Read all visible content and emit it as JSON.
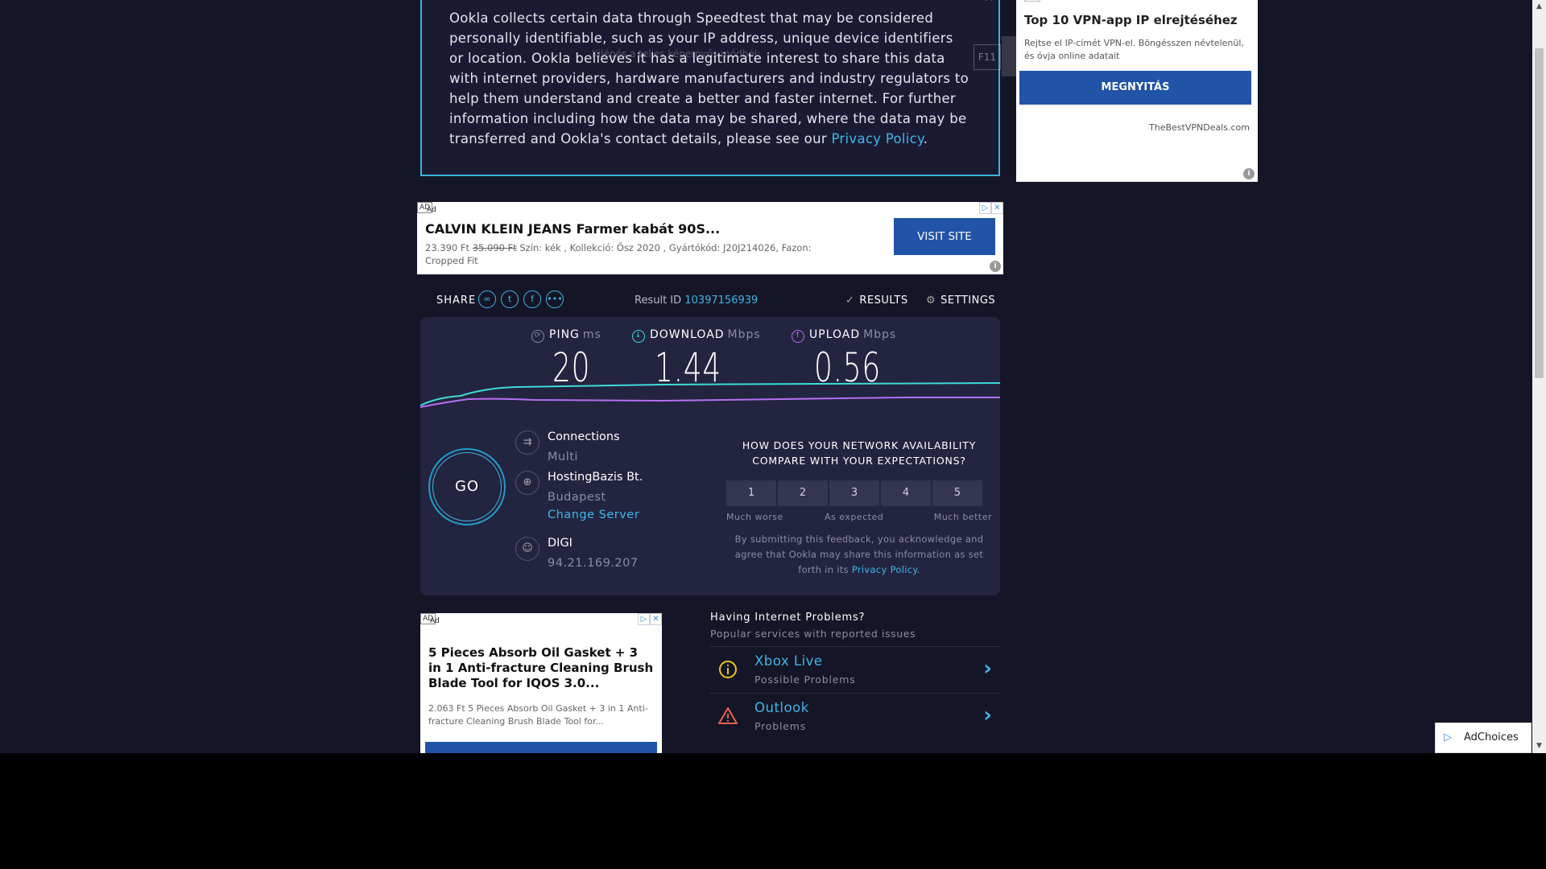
{
  "privacy": {
    "text": "Ookla collects certain data through Speedtest that may be considered personally identifiable, such as your IP address, unique device identifiers or location. Ookla believes it has a legitimate interest to share this data with internet providers, hardware manufacturers and industry regulators to help them understand and create a better and faster internet. For further information including how the data may be shared, where the data may be transferred and Ookla's contact details, please see our ",
    "link": "Privacy Policy",
    "end": "."
  },
  "fullscreen_hint": {
    "text": "Kilépés a teljes képernyős módból:",
    "key": "F11"
  },
  "ad_right": {
    "title": "Top 10 VPN-app IP elrejtéséhez",
    "desc": "Rejtse el IP-címét VPN-el. Böngésszen névtelenül, és óvja online adatait",
    "button": "MEGNYITÁS",
    "source": "TheBestVPNDeals.com"
  },
  "ad_banner": {
    "tag": "AD",
    "tag2": "Ad",
    "title": "CALVIN KLEIN JEANS Farmer kabát 90S...",
    "desc_price": "23.390 Ft",
    "desc_old": "35.090 Ft",
    "desc_rest": " Szín: kék , Kollekció: Ősz 2020 , Gyártókód: J20J214026, Fazon: Cropped Fit",
    "button": "VISIT SITE"
  },
  "share": {
    "label": "SHARE",
    "result_id_label": "Result ID",
    "result_id": "10397156939",
    "results": "RESULTS",
    "settings": "SETTINGS"
  },
  "metrics": {
    "ping": {
      "label": "PING",
      "unit": "ms",
      "value": "20"
    },
    "download": {
      "label": "DOWNLOAD",
      "unit": "Mbps",
      "value": "1.44"
    },
    "upload": {
      "label": "UPLOAD",
      "unit": "Mbps",
      "value": "0.56"
    }
  },
  "go": "GO",
  "connections": {
    "label": "Connections",
    "value": "Multi"
  },
  "server": {
    "name": "HostingBazis Bt.",
    "city": "Budapest",
    "change": "Change Server"
  },
  "isp": {
    "name": "DIGI",
    "ip": "94.21.169.207"
  },
  "survey": {
    "question": "HOW DOES YOUR NETWORK AVAILABILITY COMPARE WITH YOUR EXPECTATIONS?",
    "options": [
      "1",
      "2",
      "3",
      "4",
      "5"
    ],
    "low": "Much worse",
    "mid": "As expected",
    "high": "Much better",
    "note": "By submitting this feedback, you acknowledge and agree that Ookla may share this information as set forth in its ",
    "note_link": "Privacy Policy",
    "note_end": "."
  },
  "ad_bottom": {
    "tag": "AD",
    "tag2": "Ad",
    "title": "5 Pieces Absorb Oil Gasket + 3 in 1 Anti-fracture Cleaning Brush Blade Tool for IQOS 3.0...",
    "desc": "2.063 Ft 5 Pieces Absorb Oil Gasket + 3 in 1 Anti-fracture Cleaning Brush Blade Tool for..."
  },
  "problems": {
    "heading": "Having Internet Problems?",
    "subheading": "Popular services with reported issues",
    "items": [
      {
        "name": "Xbox Live",
        "status": "Possible Problems",
        "icon": "info-icon",
        "color": "#f0c419"
      },
      {
        "name": "Outlook",
        "status": "Problems",
        "icon": "warning-icon",
        "color": "#e8604c"
      }
    ]
  },
  "adchoices": "AdChoices",
  "colors": {
    "accent": "#3fb6e6",
    "download": "#3ddbd9",
    "upload": "#b66ff0",
    "background": "#141526"
  }
}
